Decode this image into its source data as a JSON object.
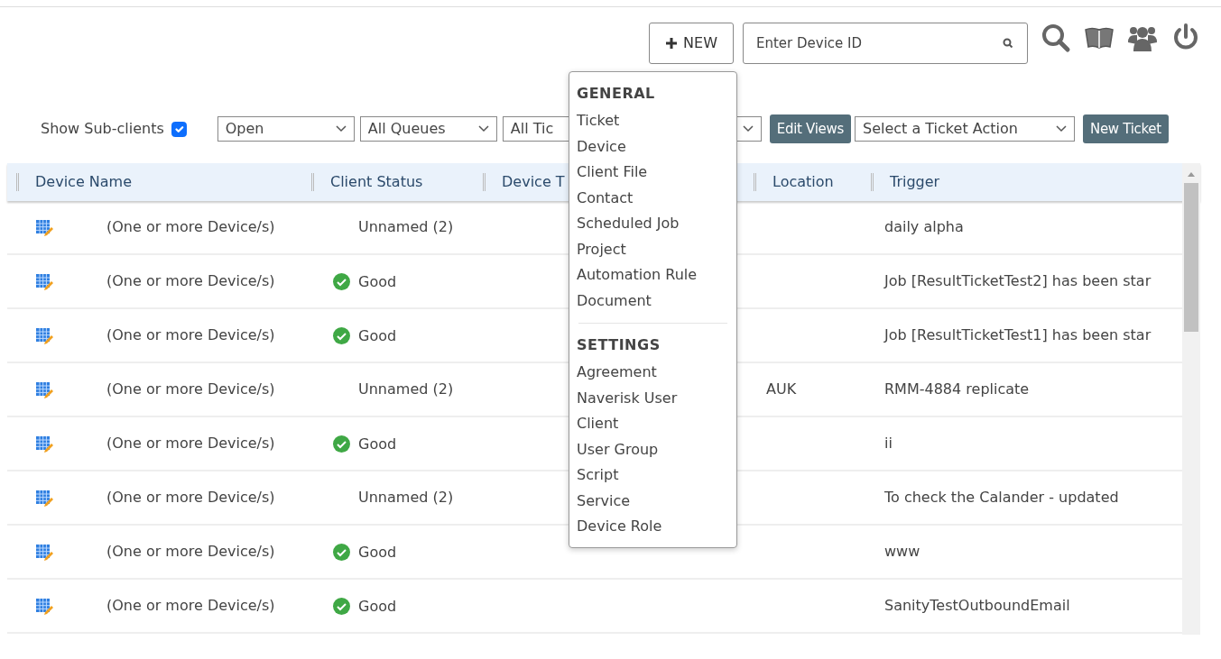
{
  "header": {
    "new_button": "NEW",
    "device_search": {
      "placeholder": "Enter Device ID"
    }
  },
  "filters": {
    "show_subclients": {
      "label": "Show Sub-clients",
      "checked": true
    },
    "selects": [
      {
        "value": "Open"
      },
      {
        "value": "All Queues"
      },
      {
        "value": "All Tic"
      }
    ],
    "edit_views": "Edit Views",
    "action_select": {
      "value": "Select a Ticket Action"
    },
    "new_ticket": "New Ticket"
  },
  "table": {
    "columns": [
      "Device Name",
      "Client Status",
      "Device T",
      "Location",
      "Trigger"
    ],
    "rows": [
      {
        "device": "(One or more Device/s)",
        "status": {
          "kind": "plain",
          "text": "Unnamed (2)"
        },
        "location": "",
        "trigger": "daily alpha"
      },
      {
        "device": "(One or more Device/s)",
        "status": {
          "kind": "good",
          "text": "Good"
        },
        "location": "",
        "trigger": "Job [ResultTicketTest2] has been star"
      },
      {
        "device": "(One or more Device/s)",
        "status": {
          "kind": "good",
          "text": "Good"
        },
        "location": "",
        "trigger": "Job [ResultTicketTest1] has been star"
      },
      {
        "device": "(One or more Device/s)",
        "status": {
          "kind": "plain",
          "text": "Unnamed (2)"
        },
        "location": "AUK",
        "trigger": "RMM-4884 replicate"
      },
      {
        "device": "(One or more Device/s)",
        "status": {
          "kind": "good",
          "text": "Good"
        },
        "location": "",
        "trigger": "ii"
      },
      {
        "device": "(One or more Device/s)",
        "status": {
          "kind": "plain",
          "text": "Unnamed (2)"
        },
        "location": "",
        "trigger": "To check the Calander - updated"
      },
      {
        "device": "(One or more Device/s)",
        "status": {
          "kind": "good",
          "text": "Good"
        },
        "location": "",
        "trigger": "www"
      },
      {
        "device": "(One or more Device/s)",
        "status": {
          "kind": "good",
          "text": "Good"
        },
        "location": "",
        "trigger": "SanityTestOutboundEmail"
      }
    ]
  },
  "new_menu": {
    "sections": [
      {
        "heading": "GENERAL",
        "items": [
          "Ticket",
          "Device",
          "Client File",
          "Contact",
          "Scheduled Job",
          "Project",
          "Automation Rule",
          "Document"
        ]
      },
      {
        "heading": "SETTINGS",
        "items": [
          "Agreement",
          "Naverisk User",
          "Client",
          "User Group",
          "Script",
          "Service",
          "Device Role"
        ]
      }
    ]
  }
}
